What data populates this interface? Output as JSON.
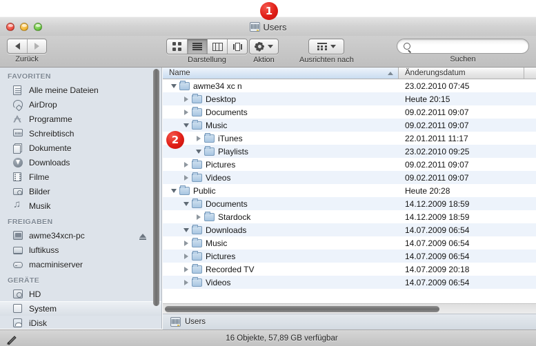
{
  "window": {
    "title": "Users",
    "title_icon": "users-folder-icon",
    "traffic_lights": [
      "close-button",
      "minimize-button",
      "zoom-button"
    ]
  },
  "toolbar": {
    "back_forward": {
      "label": "Zurück",
      "back_icon": "triangle-left-icon",
      "forward_icon": "triangle-right-icon"
    },
    "view": {
      "label": "Darstellung",
      "modes": [
        {
          "name": "icon-view",
          "icon": "grid-icon",
          "active": false
        },
        {
          "name": "list-view",
          "icon": "list-icon",
          "active": true
        },
        {
          "name": "column-view",
          "icon": "columns-icon",
          "active": false
        },
        {
          "name": "coverflow-view",
          "icon": "coverflow-icon",
          "active": false
        }
      ]
    },
    "action": {
      "label": "Aktion",
      "icon": "gear-icon",
      "caret": "chevron-down-icon"
    },
    "arrange": {
      "label": "Ausrichten nach",
      "icon": "arrange-grid-icon",
      "caret": "chevron-down-icon"
    },
    "search": {
      "label": "Suchen",
      "placeholder": "",
      "value": "",
      "icon": "search-icon"
    }
  },
  "sidebar": {
    "sections": [
      {
        "header": "FAVORITEN",
        "items": [
          {
            "label": "Alle meine Dateien",
            "icon": "all-files-icon",
            "glyph": "g-doc",
            "selected": false,
            "eject": false
          },
          {
            "label": "AirDrop",
            "icon": "airdrop-icon",
            "glyph": "g-airdrop",
            "selected": false,
            "eject": false
          },
          {
            "label": "Programme",
            "icon": "applications-icon",
            "glyph": "g-apps",
            "selected": false,
            "eject": false
          },
          {
            "label": "Schreibtisch",
            "icon": "desktop-icon",
            "glyph": "g-desk",
            "selected": false,
            "eject": false
          },
          {
            "label": "Dokumente",
            "icon": "documents-icon",
            "glyph": "g-folders",
            "selected": false,
            "eject": false
          },
          {
            "label": "Downloads",
            "icon": "downloads-icon",
            "glyph": "g-down",
            "selected": false,
            "eject": false
          },
          {
            "label": "Filme",
            "icon": "movies-icon",
            "glyph": "g-film",
            "selected": false,
            "eject": false
          },
          {
            "label": "Bilder",
            "icon": "pictures-icon",
            "glyph": "g-cam",
            "selected": false,
            "eject": false
          },
          {
            "label": "Musik",
            "icon": "music-icon",
            "glyph": "g-note",
            "selected": false,
            "eject": false
          }
        ]
      },
      {
        "header": "FREIGABEN",
        "items": [
          {
            "label": "awme34xcn-pc",
            "icon": "shared-pc-icon",
            "glyph": "g-pc",
            "selected": false,
            "eject": true
          },
          {
            "label": "luftikuss",
            "icon": "shared-laptop-icon",
            "glyph": "g-laptop",
            "selected": false,
            "eject": false
          },
          {
            "label": "macminiserver",
            "icon": "shared-server-icon",
            "glyph": "g-server",
            "selected": false,
            "eject": false
          }
        ]
      },
      {
        "header": "GERÄTE",
        "items": [
          {
            "label": "HD",
            "icon": "harddisk-icon",
            "glyph": "g-hd",
            "selected": false,
            "eject": false
          },
          {
            "label": "System",
            "icon": "volume-icon",
            "glyph": "g-vol",
            "selected": true,
            "eject": false
          },
          {
            "label": "iDisk",
            "icon": "idisk-icon",
            "glyph": "g-idisk",
            "selected": false,
            "eject": false
          }
        ]
      }
    ],
    "scrollbar": "sidebar-scrollbar"
  },
  "filelist": {
    "columns": [
      {
        "label": "Name",
        "sorted": true,
        "sort_dir": "ascending"
      },
      {
        "label": "Änderungsdatum",
        "sorted": false
      }
    ],
    "rows": [
      {
        "name": "awme34 xc n",
        "date": "23.02.2010 07:45",
        "depth": 0,
        "twisty": "open"
      },
      {
        "name": "Desktop",
        "date": "Heute 20:15",
        "depth": 1,
        "twisty": "closed"
      },
      {
        "name": "Documents",
        "date": "09.02.2011 09:07",
        "depth": 1,
        "twisty": "closed"
      },
      {
        "name": "Music",
        "date": "09.02.2011 09:07",
        "depth": 1,
        "twisty": "open"
      },
      {
        "name": "iTunes",
        "date": "22.01.2011 11:17",
        "depth": 2,
        "twisty": "closed"
      },
      {
        "name": "Playlists",
        "date": "23.02.2010 09:25",
        "depth": 2,
        "twisty": "open"
      },
      {
        "name": "Pictures",
        "date": "09.02.2011 09:07",
        "depth": 1,
        "twisty": "closed"
      },
      {
        "name": "Videos",
        "date": "09.02.2011 09:07",
        "depth": 1,
        "twisty": "closed"
      },
      {
        "name": "Public",
        "date": "Heute 20:28",
        "depth": 0,
        "twisty": "open"
      },
      {
        "name": "Documents",
        "date": "14.12.2009 18:59",
        "depth": 1,
        "twisty": "open"
      },
      {
        "name": "Stardock",
        "date": "14.12.2009 18:59",
        "depth": 2,
        "twisty": "closed"
      },
      {
        "name": "Downloads",
        "date": "14.07.2009 06:54",
        "depth": 1,
        "twisty": "open"
      },
      {
        "name": "Music",
        "date": "14.07.2009 06:54",
        "depth": 1,
        "twisty": "closed"
      },
      {
        "name": "Pictures",
        "date": "14.07.2009 06:54",
        "depth": 1,
        "twisty": "closed"
      },
      {
        "name": "Recorded TV",
        "date": "14.07.2009 20:18",
        "depth": 1,
        "twisty": "closed"
      },
      {
        "name": "Videos",
        "date": "14.07.2009 06:54",
        "depth": 1,
        "twisty": "closed"
      }
    ]
  },
  "pathbar": {
    "segment": "Users",
    "icon": "users-folder-icon"
  },
  "statusbar": {
    "text": "16 Objekte, 57,89 GB verfügbar"
  },
  "annotations": [
    {
      "number": "1",
      "target": "window-title"
    },
    {
      "number": "2",
      "target": "itunes-row"
    }
  ],
  "colors": {
    "badge_red": "#e01e16",
    "row_stripe": "#edf3fb",
    "name_column_header": "#c9dcf0",
    "sidebar_bg": "#dde3ea"
  }
}
